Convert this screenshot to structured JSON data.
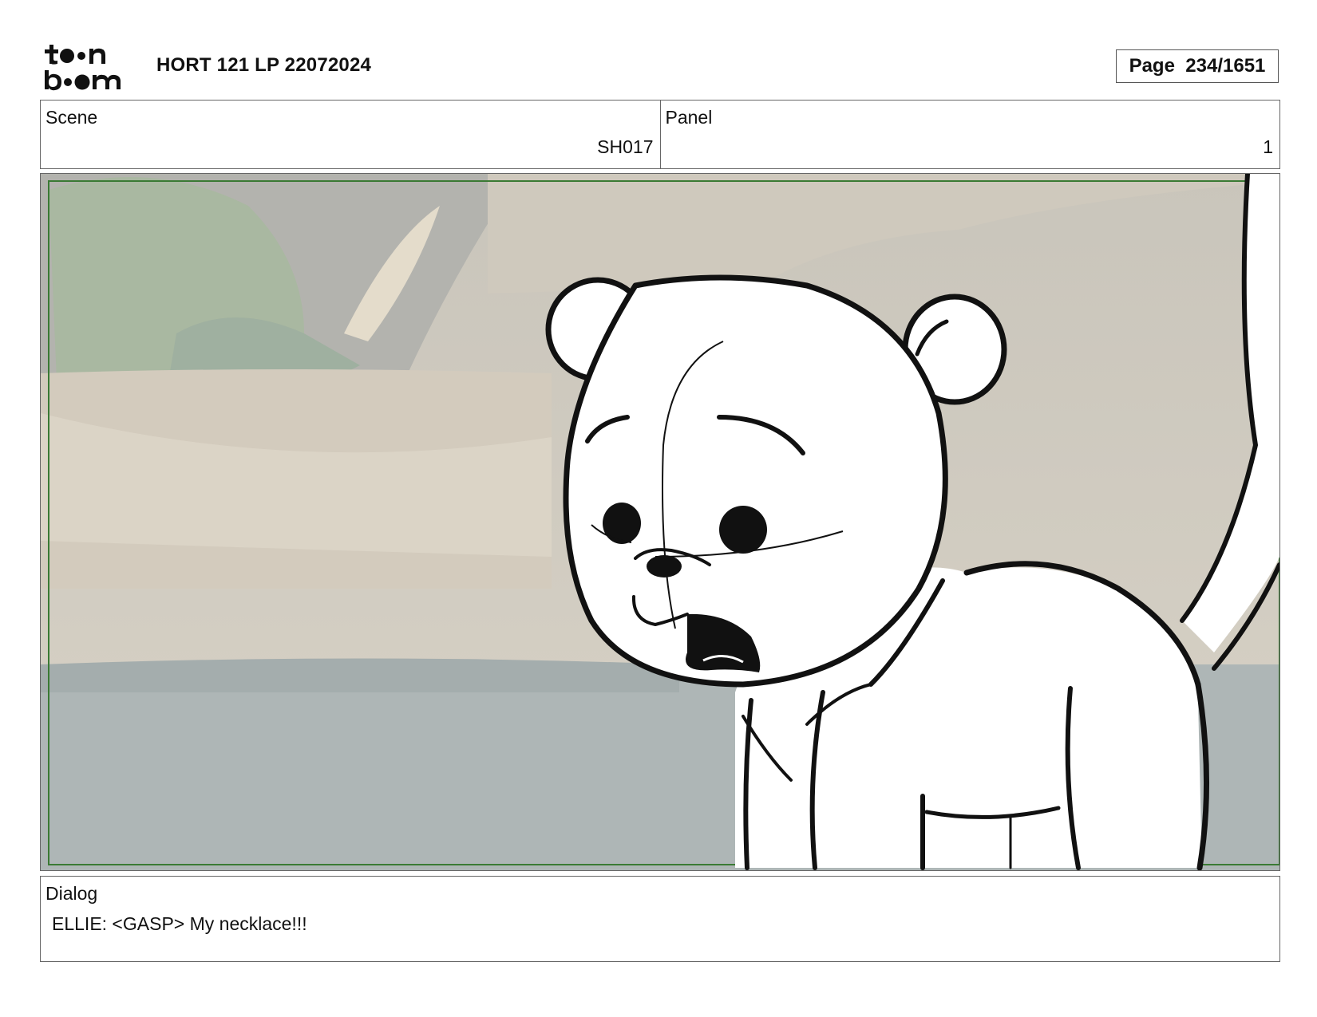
{
  "header": {
    "logo_text": "toon boom",
    "project_title": "HORT 121 LP 22072024",
    "page_label": "Page",
    "page_number": "234/1651"
  },
  "scene": {
    "label": "Scene",
    "value": "SH017"
  },
  "panel": {
    "label": "Panel",
    "value": "1"
  },
  "frame": {
    "description_icon": "storyboard-panel-drawing",
    "safe_frame_color": "#3a7a34"
  },
  "dialog": {
    "label": "Dialog",
    "text": "ELLIE: <GASP> My necklace!!!"
  }
}
